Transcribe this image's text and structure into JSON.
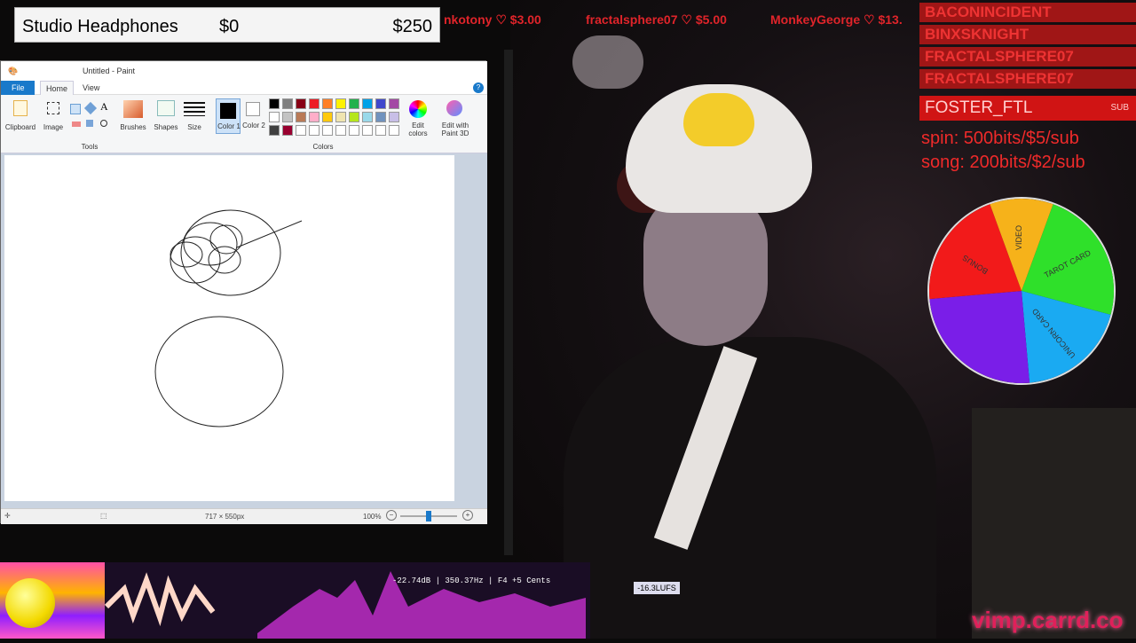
{
  "banner": {
    "item": "Studio Headphones",
    "current": "$0",
    "goal": "$250"
  },
  "donations": [
    {
      "name": "nkotony",
      "amount": "$3.00"
    },
    {
      "name": "fractalsphere07",
      "amount": "$5.00"
    },
    {
      "name": "MonkeyGeorge",
      "amount": "$13."
    }
  ],
  "chat_list": [
    "BACONINCIDENT",
    "BINXSKNIGHT",
    "FRACTALSPHERE07",
    "FRACTALSPHERE07"
  ],
  "subscriber": {
    "name": "FOSTER_FTL",
    "badge": "SUB"
  },
  "prices": {
    "spin": "spin: 500bits/$5/sub",
    "song": "song: 200bits/$2/sub"
  },
  "wheel": {
    "segments": [
      {
        "label": "TAROT CARD",
        "color": "#2fe02a"
      },
      {
        "label": "UNICORN CARD",
        "color": "#1aaaf2"
      },
      {
        "label": "",
        "color": "#7a1ee8"
      },
      {
        "label": "BONUS",
        "color": "#f21a1a"
      },
      {
        "label": "VIDEO",
        "color": "#f6b21a"
      }
    ]
  },
  "paint": {
    "title": "Untitled - Paint",
    "menu": {
      "file": "File",
      "home": "Home",
      "view": "View"
    },
    "groups": {
      "clipboard": "Clipboard",
      "image": "Image",
      "tools": "Tools",
      "brushes": "Brushes",
      "shapes": "Shapes",
      "size": "Size",
      "color1": "Color 1",
      "color2": "Color 2",
      "colors": "Colors",
      "edit_colors": "Edit colors",
      "edit_with": "Edit with Paint 3D"
    },
    "palette": [
      "#000000",
      "#7f7f7f",
      "#880015",
      "#ed1c24",
      "#ff7f27",
      "#fff200",
      "#22b14c",
      "#00a2e8",
      "#3f48cc",
      "#a349a4",
      "#ffffff",
      "#c3c3c3",
      "#b97a57",
      "#ffaec9",
      "#ffc90e",
      "#efe4b0",
      "#b5e61d",
      "#99d9ea",
      "#7092be",
      "#c8bfe7",
      "#404040",
      "#990030",
      "#ffffff",
      "#ffffff",
      "#ffffff",
      "#ffffff",
      "#ffffff",
      "#ffffff",
      "#ffffff",
      "#ffffff"
    ],
    "status": {
      "dimensions": "717 × 550px",
      "zoom": "100%",
      "zoom_level": 0.5
    }
  },
  "visualizer": {
    "readout": "-22.74dB | 350.37Hz | F4 +5 Cents",
    "lufs": "-16.3LUFS"
  },
  "brand": "vimp.carrd.co"
}
